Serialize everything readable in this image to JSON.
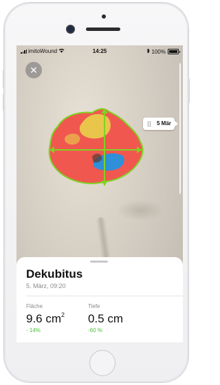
{
  "status": {
    "carrier": "imitoWound",
    "time": "14:25",
    "battery": "100%"
  },
  "photo": {
    "date_marker": "5 Mär"
  },
  "card": {
    "title": "Dekubitus",
    "date": "5. März, 09:20",
    "metrics": {
      "area": {
        "label": "Fläche",
        "value": "9.6 cm",
        "unit_sup": "2",
        "change": "- 14%"
      },
      "depth": {
        "label": "Tiefe",
        "value": "0.5 cm",
        "change": "-60 %"
      }
    }
  },
  "colors": {
    "measure_line": "#7ed321",
    "change_positive": "#4cc03a",
    "wound_red": "#f0584f",
    "wound_yellow": "#e8d24a",
    "wound_blue": "#2f8fd8"
  },
  "icons": {
    "close": "close-icon",
    "wifi": "wifi-icon",
    "bluetooth": "bluetooth-icon",
    "battery": "battery-icon",
    "grip": "grip-icon"
  }
}
